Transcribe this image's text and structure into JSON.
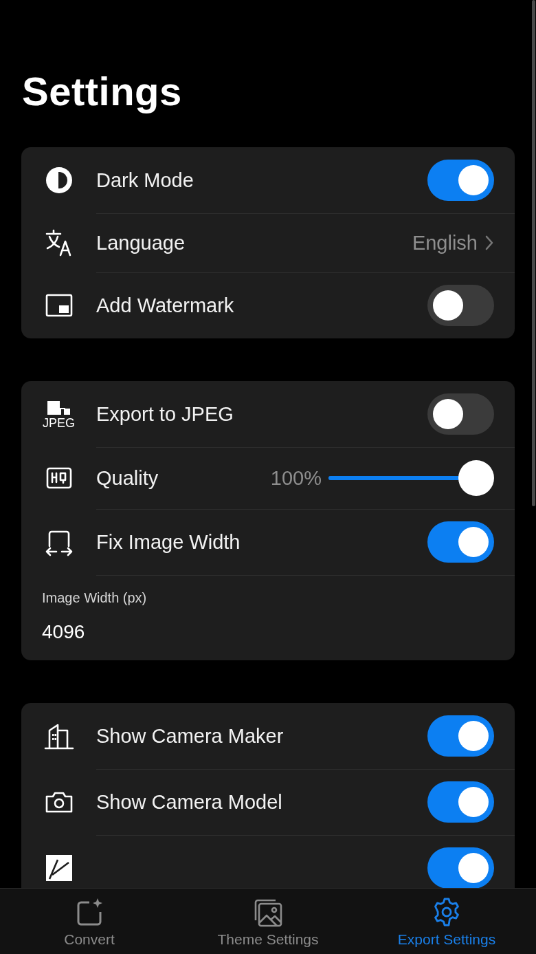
{
  "title": "Settings",
  "groups": [
    {
      "rows": [
        {
          "kind": "toggle",
          "label": "Dark Mode",
          "on": true
        },
        {
          "kind": "link",
          "label": "Language",
          "value": "English"
        },
        {
          "kind": "toggle",
          "label": "Add Watermark",
          "on": false
        }
      ]
    },
    {
      "rows": [
        {
          "kind": "toggle",
          "label": "Export to JPEG",
          "on": false,
          "icon_text": "JPEG"
        },
        {
          "kind": "slider",
          "label": "Quality",
          "reading": "100%",
          "level": 1
        },
        {
          "kind": "toggle",
          "label": "Fix Image Width",
          "on": true
        },
        {
          "kind": "field",
          "label": "Image Width (px)",
          "value": "4096"
        }
      ]
    },
    {
      "rows": [
        {
          "kind": "toggle",
          "label": "Show Camera Maker",
          "on": true
        },
        {
          "kind": "toggle",
          "label": "Show Camera Model",
          "on": true
        },
        {
          "kind": "toggle",
          "on": true
        }
      ]
    }
  ],
  "tabs": [
    {
      "label": "Convert",
      "selected": false
    },
    {
      "label": "Theme Settings",
      "selected": false
    },
    {
      "label": "Export Settings",
      "selected": true
    }
  ]
}
